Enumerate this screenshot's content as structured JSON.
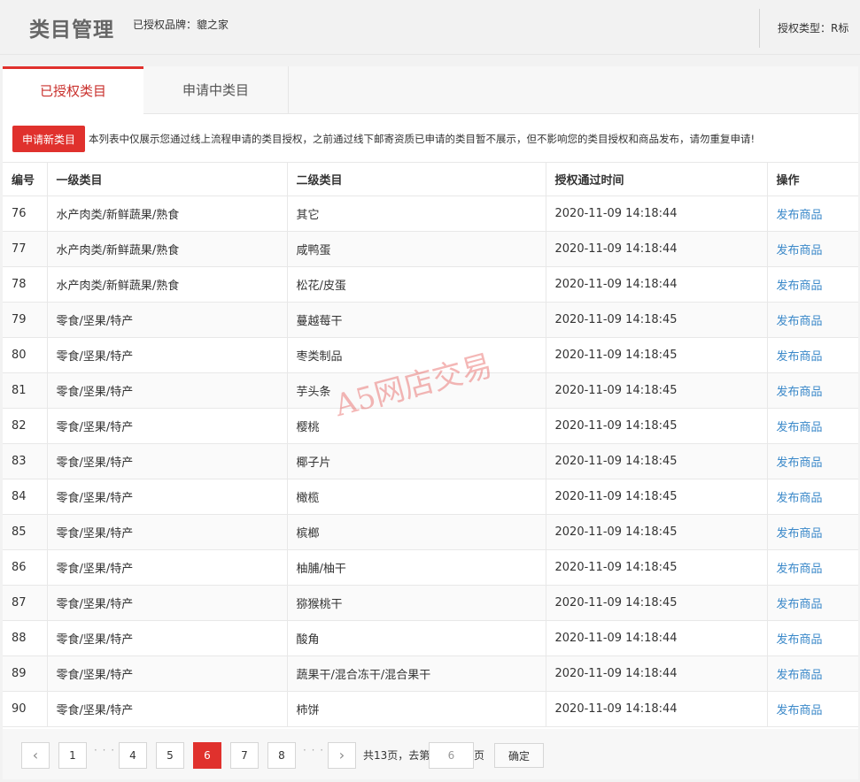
{
  "header": {
    "title": "类目管理",
    "brand_text": "已授权品牌：貔之家",
    "auth_type_text": "授权类型：R标"
  },
  "tabs": [
    {
      "label": "已授权类目",
      "active": true
    },
    {
      "label": "申请中类目",
      "active": false
    }
  ],
  "notice": {
    "button_label": "申请新类目",
    "text": "本列表中仅展示您通过线上流程申请的类目授权，之前通过线下邮寄资质已申请的类目暂不展示，但不影响您的类目授权和商品发布，请勿重复申请!"
  },
  "table": {
    "columns": [
      "编号",
      "一级类目",
      "二级类目",
      "授权通过时间",
      "操作"
    ],
    "action_label": "发布商品",
    "rows": [
      {
        "id": "76",
        "cat1": "水产肉类/新鲜蔬果/熟食",
        "cat2": "其它",
        "time": "2020-11-09 14:18:44",
        "action": "发布商品"
      },
      {
        "id": "77",
        "cat1": "水产肉类/新鲜蔬果/熟食",
        "cat2": "咸鸭蛋",
        "time": "2020-11-09 14:18:44",
        "action": "发布商品"
      },
      {
        "id": "78",
        "cat1": "水产肉类/新鲜蔬果/熟食",
        "cat2": "松花/皮蛋",
        "time": "2020-11-09 14:18:44",
        "action": "发布商品"
      },
      {
        "id": "79",
        "cat1": "零食/坚果/特产",
        "cat2": "蔓越莓干",
        "time": "2020-11-09 14:18:45",
        "action": "发布商品"
      },
      {
        "id": "80",
        "cat1": "零食/坚果/特产",
        "cat2": "枣类制品",
        "time": "2020-11-09 14:18:45",
        "action": "发布商品"
      },
      {
        "id": "81",
        "cat1": "零食/坚果/特产",
        "cat2": "芋头条",
        "time": "2020-11-09 14:18:45",
        "action": "发布商品"
      },
      {
        "id": "82",
        "cat1": "零食/坚果/特产",
        "cat2": "樱桃",
        "time": "2020-11-09 14:18:45",
        "action": "发布商品"
      },
      {
        "id": "83",
        "cat1": "零食/坚果/特产",
        "cat2": "椰子片",
        "time": "2020-11-09 14:18:45",
        "action": "发布商品"
      },
      {
        "id": "84",
        "cat1": "零食/坚果/特产",
        "cat2": "橄榄",
        "time": "2020-11-09 14:18:45",
        "action": "发布商品"
      },
      {
        "id": "85",
        "cat1": "零食/坚果/特产",
        "cat2": "槟榔",
        "time": "2020-11-09 14:18:45",
        "action": "发布商品"
      },
      {
        "id": "86",
        "cat1": "零食/坚果/特产",
        "cat2": "柚脯/柚干",
        "time": "2020-11-09 14:18:45",
        "action": "发布商品"
      },
      {
        "id": "87",
        "cat1": "零食/坚果/特产",
        "cat2": "猕猴桃干",
        "time": "2020-11-09 14:18:45",
        "action": "发布商品"
      },
      {
        "id": "88",
        "cat1": "零食/坚果/特产",
        "cat2": "酸角",
        "time": "2020-11-09 14:18:44",
        "action": "发布商品"
      },
      {
        "id": "89",
        "cat1": "零食/坚果/特产",
        "cat2": "蔬果干/混合冻干/混合果干",
        "time": "2020-11-09 14:18:44",
        "action": "发布商品"
      },
      {
        "id": "90",
        "cat1": "零食/坚果/特产",
        "cat2": "柿饼",
        "time": "2020-11-09 14:18:44",
        "action": "发布商品"
      }
    ]
  },
  "pagination": {
    "prev_icon": "chevron-left-icon",
    "next_icon": "chevron-right-icon",
    "prev_glyph": "‹",
    "next_glyph": "›",
    "ellipsis": "· · ·",
    "pages": [
      "1",
      "4",
      "5",
      "6",
      "7",
      "8"
    ],
    "current": "6",
    "total_text": "共13页，去第",
    "goto_value": "6",
    "page_unit": "页",
    "confirm_label": "确定"
  },
  "watermark": "A5网店交易",
  "colors": {
    "accent": "#e0312d",
    "link": "#3a88c9"
  }
}
